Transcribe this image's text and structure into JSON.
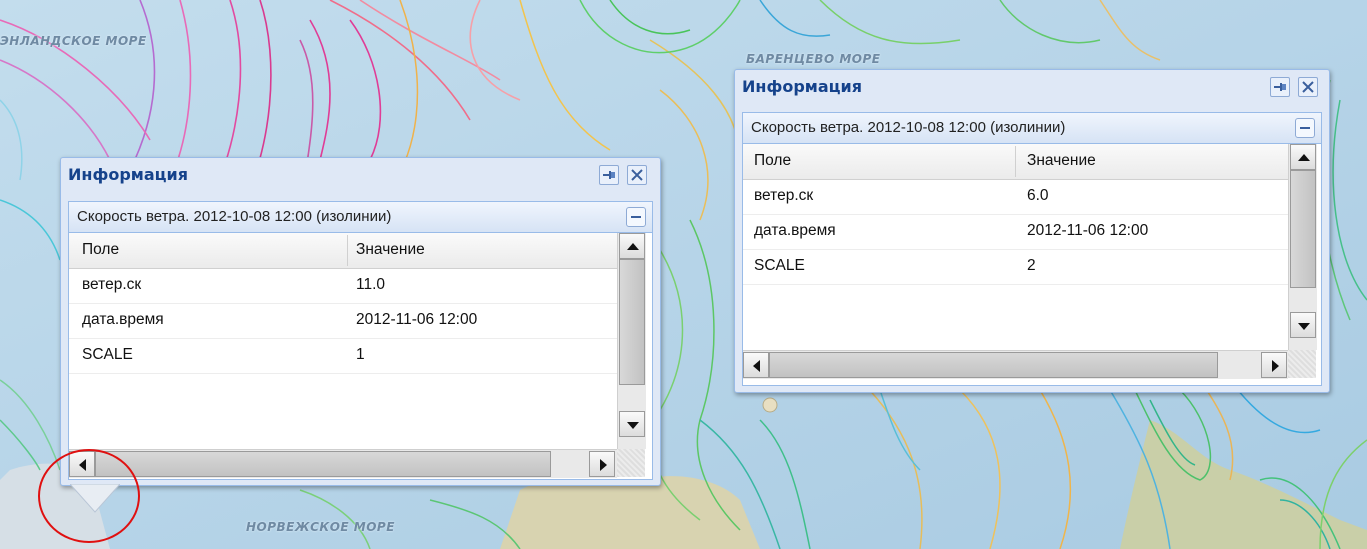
{
  "map": {
    "sea_labels": [
      "ЭНЛАНДСКОЕ МОРЕ",
      "БАРЕНЦЕВО МОРЕ",
      "НОРВЕЖСКОЕ МОРЕ"
    ]
  },
  "popups": [
    {
      "title": "Информация",
      "layer_title": "Скорость ветра. 2012-10-08 12:00 (изолинии)",
      "columns": [
        "Поле",
        "Значение"
      ],
      "rows": [
        {
          "field": "ветер.ск",
          "value": "11.0"
        },
        {
          "field": "дата.время",
          "value": "2012-11-06 12:00"
        },
        {
          "field": "SCALE",
          "value": "1"
        }
      ]
    },
    {
      "title": "Информация",
      "layer_title": "Скорость ветра. 2012-10-08 12:00 (изолинии)",
      "columns": [
        "Поле",
        "Значение"
      ],
      "rows": [
        {
          "field": "ветер.ск",
          "value": "6.0"
        },
        {
          "field": "дата.время",
          "value": "2012-11-06 12:00"
        },
        {
          "field": "SCALE",
          "value": "2"
        }
      ]
    }
  ],
  "colors": {
    "title": "#15428b",
    "panel_border": "#99bbe8",
    "highlight_circle": "#e01010"
  },
  "icons": [
    "pin-icon",
    "close-icon",
    "collapse-icon",
    "arrow-up-icon",
    "arrow-down-icon",
    "arrow-left-icon",
    "arrow-right-icon"
  ]
}
